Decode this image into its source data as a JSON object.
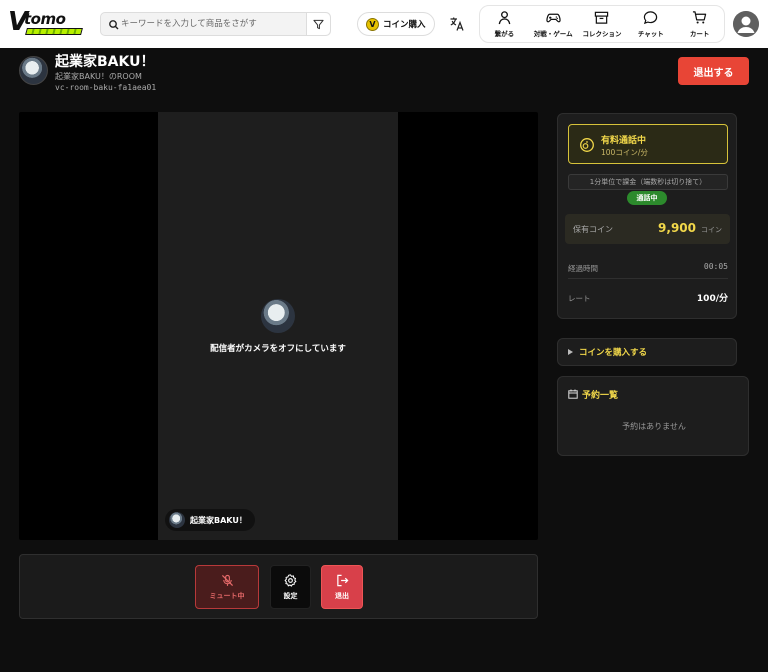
{
  "header": {
    "logo_text": "tomo",
    "search_placeholder": "キーワードを入力して商品をさがす",
    "coin_button_label": "コイン購入",
    "nav": [
      {
        "label": "繋がる",
        "icon": "person-icon"
      },
      {
        "label": "対戦・ゲーム",
        "icon": "gamepad-icon"
      },
      {
        "label": "コレクション",
        "icon": "archive-icon"
      },
      {
        "label": "チャット",
        "icon": "chat-icon"
      },
      {
        "label": "カート",
        "icon": "cart-icon"
      }
    ]
  },
  "room": {
    "title": "起業家BAKU！",
    "subtitle": "起業家BAKU！のROOM",
    "room_id": "vc-room-baku-fa1aea01",
    "leave_button": "退出する"
  },
  "video": {
    "camera_off_message": "配信者がカメラをオフにしています",
    "participant_name": "起業家BAKU！"
  },
  "controls": {
    "mute_label": "ミュート中",
    "settings_label": "設定",
    "exit_label": "退出"
  },
  "call_panel": {
    "paid_title": "有料通話中",
    "paid_rate": "100コイン/分",
    "billing_note": "1分単位で課金（端数秒は切り捨て）",
    "status": "通話中",
    "coins_label": "保有コイン",
    "coins_value": "9,900",
    "coins_unit": "コイン",
    "elapsed_label": "経過時間",
    "elapsed_value": "00:05",
    "rate_label": "レート",
    "rate_value": "100/分"
  },
  "buy_coins": {
    "label": "コインを購入する"
  },
  "reservations": {
    "title": "予約一覧",
    "empty_message": "予約はありません"
  },
  "colors": {
    "accent_yellow": "#f2d84a",
    "danger_red": "#e84536",
    "status_green": "#2c8a2c"
  }
}
